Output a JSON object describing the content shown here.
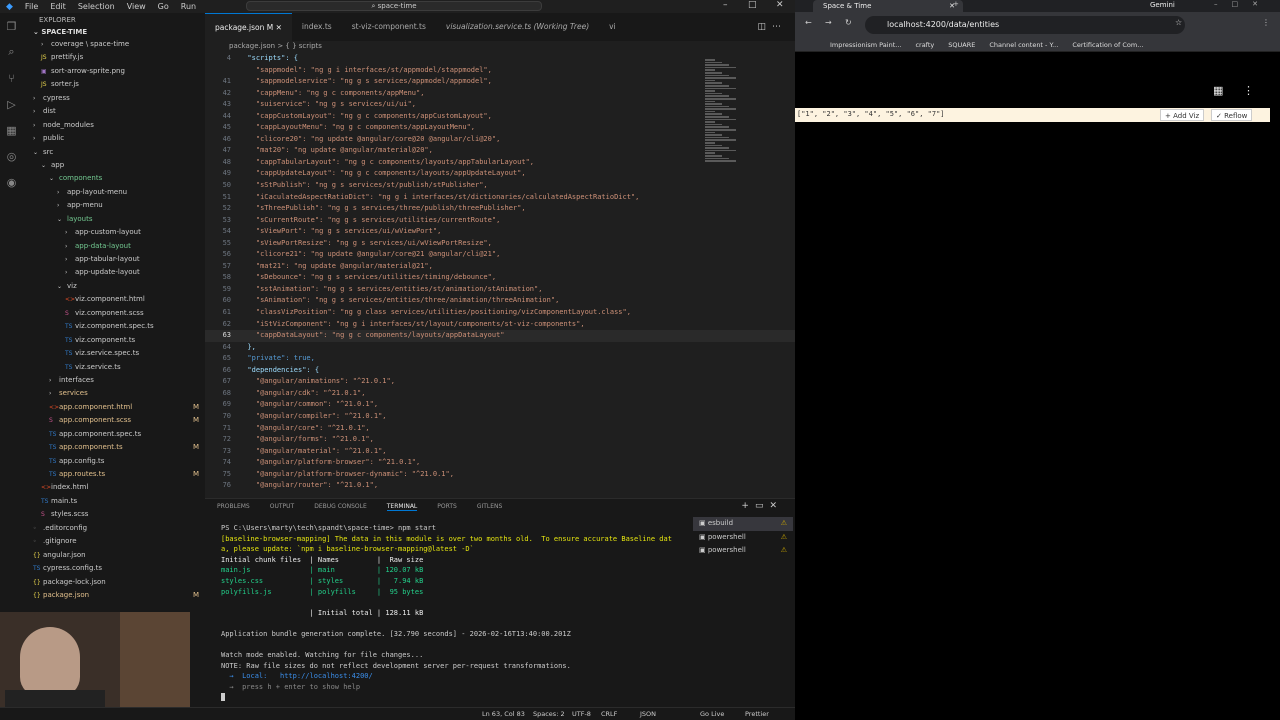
{
  "vscode": {
    "menu": [
      "File",
      "Edit",
      "Selection",
      "View",
      "Go",
      "Run"
    ],
    "search": "space-time",
    "explorer_title": "EXPLORER",
    "root": "SPACE-TIME",
    "tree": [
      {
        "label": "coverage \\ space-time",
        "indent": 1,
        "kind": "folder"
      },
      {
        "label": "prettify.js",
        "indent": 1,
        "kind": "js"
      },
      {
        "label": "sort-arrow-sprite.png",
        "indent": 1,
        "kind": "img"
      },
      {
        "label": "sorter.js",
        "indent": 1,
        "kind": "js"
      },
      {
        "label": "cypress",
        "indent": 0,
        "kind": "folder"
      },
      {
        "label": "dist",
        "indent": 0,
        "kind": "folder"
      },
      {
        "label": "node_modules",
        "indent": 0,
        "kind": "folder"
      },
      {
        "label": "public",
        "indent": 0,
        "kind": "folder"
      },
      {
        "label": "src",
        "indent": 0,
        "kind": "folder-open"
      },
      {
        "label": "app",
        "indent": 1,
        "kind": "folder-open"
      },
      {
        "label": "components",
        "indent": 2,
        "kind": "folder-open",
        "color": "#73c991"
      },
      {
        "label": "app-layout-menu",
        "indent": 3,
        "kind": "folder"
      },
      {
        "label": "app-menu",
        "indent": 3,
        "kind": "folder"
      },
      {
        "label": "layouts",
        "indent": 3,
        "kind": "folder-open",
        "color": "#73c991"
      },
      {
        "label": "app-custom-layout",
        "indent": 4,
        "kind": "folder"
      },
      {
        "label": "app-data-layout",
        "indent": 4,
        "kind": "folder",
        "color": "#73c991"
      },
      {
        "label": "app-tabular-layout",
        "indent": 4,
        "kind": "folder"
      },
      {
        "label": "app-update-layout",
        "indent": 4,
        "kind": "folder"
      },
      {
        "label": "viz",
        "indent": 3,
        "kind": "folder-open"
      },
      {
        "label": "viz.component.html",
        "indent": 4,
        "kind": "html"
      },
      {
        "label": "viz.component.scss",
        "indent": 4,
        "kind": "scss"
      },
      {
        "label": "viz.component.spec.ts",
        "indent": 4,
        "kind": "ts"
      },
      {
        "label": "viz.component.ts",
        "indent": 4,
        "kind": "ts"
      },
      {
        "label": "viz.service.spec.ts",
        "indent": 4,
        "kind": "ts"
      },
      {
        "label": "viz.service.ts",
        "indent": 4,
        "kind": "ts"
      },
      {
        "label": "interfaces",
        "indent": 2,
        "kind": "folder"
      },
      {
        "label": "services",
        "indent": 2,
        "kind": "folder",
        "color": "#e2c08d"
      },
      {
        "label": "app.component.html",
        "indent": 2,
        "kind": "html",
        "color": "#e2c08d",
        "badge": "M"
      },
      {
        "label": "app.component.scss",
        "indent": 2,
        "kind": "scss",
        "color": "#e2c08d",
        "badge": "M"
      },
      {
        "label": "app.component.spec.ts",
        "indent": 2,
        "kind": "ts"
      },
      {
        "label": "app.component.ts",
        "indent": 2,
        "kind": "ts",
        "color": "#e2c08d",
        "badge": "M"
      },
      {
        "label": "app.config.ts",
        "indent": 2,
        "kind": "ts"
      },
      {
        "label": "app.routes.ts",
        "indent": 2,
        "kind": "ts",
        "color": "#e2c08d",
        "badge": "M"
      },
      {
        "label": "index.html",
        "indent": 1,
        "kind": "html"
      },
      {
        "label": "main.ts",
        "indent": 1,
        "kind": "ts"
      },
      {
        "label": "styles.scss",
        "indent": 1,
        "kind": "scss"
      },
      {
        "label": ".editorconfig",
        "indent": 0,
        "kind": "cfg"
      },
      {
        "label": ".gitignore",
        "indent": 0,
        "kind": "cfg"
      },
      {
        "label": "angular.json",
        "indent": 0,
        "kind": "json"
      },
      {
        "label": "cypress.config.ts",
        "indent": 0,
        "kind": "ts"
      },
      {
        "label": "package-lock.json",
        "indent": 0,
        "kind": "json"
      },
      {
        "label": "package.json",
        "indent": 0,
        "kind": "json",
        "color": "#e2c08d",
        "badge": "M"
      }
    ],
    "tabs": [
      {
        "label": "package.json M",
        "active": true
      },
      {
        "label": "index.ts",
        "active": false
      },
      {
        "label": "st-viz-component.ts",
        "active": false
      },
      {
        "label": "visualization.service.ts (Working Tree)",
        "active": false
      },
      {
        "label": "vi",
        "active": false
      }
    ],
    "breadcrumb": "package.json > { } scripts",
    "code": [
      {
        "n": "4",
        "t": "  \"scripts\": {"
      },
      {
        "n": "",
        "t": "    \"sappmodel\": \"ng g i interfaces/st/appmodel/stappmodel\","
      },
      {
        "n": "41",
        "t": "    \"sappmodelservice\": \"ng g s services/appmodel/appmodel\","
      },
      {
        "n": "42",
        "t": "    \"cappMenu\": \"ng g c components/appMenu\","
      },
      {
        "n": "43",
        "t": "    \"suiservice\": \"ng g s services/ui/ui\","
      },
      {
        "n": "44",
        "t": "    \"cappCustomLayout\": \"ng g c components/appCustomLayout\","
      },
      {
        "n": "45",
        "t": "    \"cappLayoutMenu\": \"ng g c components/appLayoutMenu\","
      },
      {
        "n": "46",
        "t": "    \"clicore20\": \"ng update @angular/core@20 @angular/cli@20\","
      },
      {
        "n": "47",
        "t": "    \"mat20\": \"ng update @angular/material@20\","
      },
      {
        "n": "48",
        "t": "    \"cappTabularLayout\": \"ng g c components/layouts/appTabularLayout\","
      },
      {
        "n": "49",
        "t": "    \"cappUpdateLayout\": \"ng g c components/layouts/appUpdateLayout\","
      },
      {
        "n": "50",
        "t": "    \"sStPublish\": \"ng g s services/st/publish/stPublisher\","
      },
      {
        "n": "51",
        "t": "    \"iCaculatedAspectRatioDict\": \"ng g i interfaces/st/dictionaries/calculatedAspectRatioDict\","
      },
      {
        "n": "52",
        "t": "    \"sThreePublish\": \"ng g s services/three/publish/threePublisher\","
      },
      {
        "n": "53",
        "t": "    \"sCurrentRoute\": \"ng g s services/utilities/currentRoute\","
      },
      {
        "n": "54",
        "t": "    \"sViewPort\": \"ng g s services/ui/wViewPort\","
      },
      {
        "n": "55",
        "t": "    \"sViewPortResize\": \"ng g s services/ui/wViewPortResize\","
      },
      {
        "n": "56",
        "t": "    \"clicore21\": \"ng update @angular/core@21 @angular/cli@21\","
      },
      {
        "n": "57",
        "t": "    \"mat21\": \"ng update @angular/material@21\","
      },
      {
        "n": "58",
        "t": "    \"sDebounce\": \"ng g s services/utilities/timing/debounce\","
      },
      {
        "n": "59",
        "t": "    \"sstAnimation\": \"ng g s services/entities/st/animation/stAnimation\","
      },
      {
        "n": "60",
        "t": "    \"sAnimation\": \"ng g s services/entities/three/animation/threeAnimation\","
      },
      {
        "n": "61",
        "t": "    \"classVizPosition\": \"ng g class services/utilities/positioning/vizComponentLayout.class\","
      },
      {
        "n": "62",
        "t": "    \"iStVizComponent\": \"ng g i interfaces/st/layout/components/st-viz-components\","
      },
      {
        "n": "63",
        "t": "    \"cappDataLayout\": \"ng g c components/layouts/appDataLayout\""
      },
      {
        "n": "64",
        "t": "  },"
      },
      {
        "n": "65",
        "t": "  \"private\": true,"
      },
      {
        "n": "66",
        "t": "  \"dependencies\": {"
      },
      {
        "n": "67",
        "t": "    \"@angular/animations\": \"^21.0.1\","
      },
      {
        "n": "68",
        "t": "    \"@angular/cdk\": \"^21.0.1\","
      },
      {
        "n": "69",
        "t": "    \"@angular/common\": \"^21.0.1\","
      },
      {
        "n": "70",
        "t": "    \"@angular/compiler\": \"^21.0.1\","
      },
      {
        "n": "71",
        "t": "    \"@angular/core\": \"^21.0.1\","
      },
      {
        "n": "72",
        "t": "    \"@angular/forms\": \"^21.0.1\","
      },
      {
        "n": "73",
        "t": "    \"@angular/material\": \"^21.0.1\","
      },
      {
        "n": "74",
        "t": "    \"@angular/platform-browser\": \"^21.0.1\","
      },
      {
        "n": "75",
        "t": "    \"@angular/platform-browser-dynamic\": \"^21.0.1\","
      },
      {
        "n": "76",
        "t": "    \"@angular/router\": \"^21.0.1\","
      }
    ],
    "current_line": "63",
    "panel_tabs": [
      "PROBLEMS",
      "OUTPUT",
      "DEBUG CONSOLE",
      "TERMINAL",
      "PORTS",
      "GITLENS"
    ],
    "panel_active": "TERMINAL",
    "terminal": [
      {
        "t": "PS C:\\Users\\marty\\tech\\spandt\\space-time> npm start",
        "c": "#ccc"
      },
      {
        "t": "[baseline-browser-mapping] The data in this module is over two months old.  To ensure accurate Baseline dat",
        "c": "#e5e510"
      },
      {
        "t": "a, please update: `npm i baseline-browser-mapping@latest -D`",
        "c": "#e5e510"
      },
      {
        "t": "Initial chunk files  | Names         |  Raw size",
        "c": "#eee"
      },
      {
        "t": "main.js              | main          | 120.07 kB",
        "c": "#23d18b"
      },
      {
        "t": "styles.css           | styles        |   7.94 kB",
        "c": "#23d18b"
      },
      {
        "t": "polyfills.js         | polyfills     |  95 bytes",
        "c": "#23d18b"
      },
      {
        "t": "",
        "c": "#ccc"
      },
      {
        "t": "                     | Initial total | 128.11 kB",
        "c": "#eee"
      },
      {
        "t": "",
        "c": "#ccc"
      },
      {
        "t": "Application bundle generation complete. [32.790 seconds] - 2026-02-16T13:40:00.201Z",
        "c": "#ccc"
      },
      {
        "t": "",
        "c": "#ccc"
      },
      {
        "t": "Watch mode enabled. Watching for file changes...",
        "c": "#ccc"
      },
      {
        "t": "NOTE: Raw file sizes do not reflect development server per-request transformations.",
        "c": "#ccc"
      },
      {
        "t": "  →  Local:   http://localhost:4200/",
        "c": "#3b8eea"
      },
      {
        "t": "  →  press h + enter to show help",
        "c": "#888"
      }
    ],
    "terminal_list": [
      "esbuild",
      "powershell",
      "powershell"
    ],
    "status": {
      "position": "Ln 63, Col 83",
      "spaces": "Spaces: 2",
      "encoding": "UTF-8",
      "eol": "CRLF",
      "language": "JSON",
      "golive": "Go Live",
      "prettier": "Prettier"
    }
  },
  "browser": {
    "tab_title": "Space & Time",
    "profile": "Gemini",
    "url": "localhost:4200/data/entities",
    "bookmarks": [
      "Impressionism Paint...",
      "crafty",
      "SQUARE",
      "Channel content - Y...",
      "Certification of Com..."
    ],
    "app_text": "[\"1\", \"2\", \"3\", \"4\", \"5\", \"6\", \"7\"]",
    "add_viz": "Add Viz",
    "reflow": "Reflow"
  }
}
